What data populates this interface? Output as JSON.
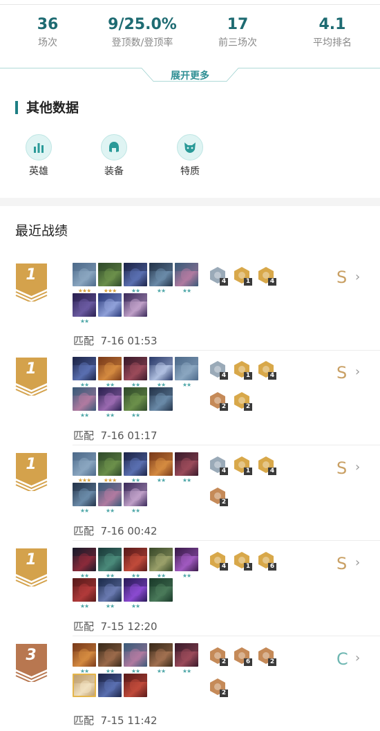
{
  "stats": [
    {
      "value": "36",
      "label": "场次"
    },
    {
      "value": "9/25.0%",
      "label": "登顶数/登顶率"
    },
    {
      "value": "17",
      "label": "前三场次"
    },
    {
      "value": "4.1",
      "label": "平均排名"
    }
  ],
  "expand_label": "展开更多",
  "other_data": {
    "title": "其他数据",
    "items": [
      {
        "label": "英雄",
        "icon": "bar-chart-icon"
      },
      {
        "label": "装备",
        "icon": "helmet-icon"
      },
      {
        "label": "特质",
        "icon": "cat-mask-icon"
      }
    ]
  },
  "recent_title": "最近战绩",
  "colors": {
    "accent": "#1e6b72",
    "gold_badge": "#d4a24c",
    "bronze_badge": "#b87750",
    "grade_s": "#c9a064",
    "grade_c": "#6fb7b2",
    "trait_bronze": "#c58a58",
    "trait_gold": "#d8a84a",
    "trait_silver": "#9aaab8"
  },
  "matches": [
    {
      "rank": "1",
      "badge": "gold",
      "mode": "匹配",
      "time": "7-16 01:53",
      "grade": "S",
      "champions": [
        {
          "colors": [
            "#4d6a8a",
            "#8aa6c0"
          ],
          "stars": 3
        },
        {
          "colors": [
            "#2f4a2a",
            "#6b8f4a"
          ],
          "stars": 3
        },
        {
          "colors": [
            "#1c2448",
            "#5a6fb0"
          ],
          "stars": 2
        },
        {
          "colors": [
            "#24344a",
            "#6a8aa8"
          ],
          "stars": 2
        },
        {
          "colors": [
            "#3a5a78",
            "#b07aa0"
          ],
          "stars": 2
        },
        {
          "colors": [
            "#2a2050",
            "#6a5aa0"
          ],
          "stars": 2
        },
        {
          "colors": [
            "#2a3a7a",
            "#8fa0d8"
          ],
          "stars": 0
        },
        {
          "colors": [
            "#3a2a5a",
            "#c0a0c8"
          ],
          "stars": 0
        }
      ],
      "traits": [
        {
          "tier": "silver",
          "count": "4"
        },
        {
          "tier": "gold",
          "count": "1"
        },
        {
          "tier": "gold",
          "count": "4"
        }
      ]
    },
    {
      "rank": "1",
      "badge": "gold",
      "mode": "匹配",
      "time": "7-16 01:17",
      "grade": "S",
      "champions": [
        {
          "colors": [
            "#1c2448",
            "#5a6fb0"
          ],
          "stars": 2
        },
        {
          "colors": [
            "#7a3a1a",
            "#d48a40"
          ],
          "stars": 2
        },
        {
          "colors": [
            "#3a1a2a",
            "#9a4a5a"
          ],
          "stars": 2
        },
        {
          "colors": [
            "#2a3a6a",
            "#b0c0e0"
          ],
          "stars": 2
        },
        {
          "colors": [
            "#4d6a8a",
            "#8aa6c0"
          ],
          "stars": 2
        },
        {
          "colors": [
            "#3a5a78",
            "#b07aa0"
          ],
          "stars": 2
        },
        {
          "colors": [
            "#2a2050",
            "#9a6ab0"
          ],
          "stars": 2
        },
        {
          "colors": [
            "#2f4a2a",
            "#6b8f4a"
          ],
          "stars": 2
        },
        {
          "colors": [
            "#24344a",
            "#6a8aa8"
          ],
          "stars": 0
        }
      ],
      "traits": [
        {
          "tier": "silver",
          "count": "4"
        },
        {
          "tier": "gold",
          "count": "1"
        },
        {
          "tier": "gold",
          "count": "4"
        },
        {
          "tier": "bronze",
          "count": "2"
        },
        {
          "tier": "gold",
          "count": "2"
        }
      ]
    },
    {
      "rank": "1",
      "badge": "gold",
      "mode": "匹配",
      "time": "7-16 00:42",
      "grade": "S",
      "champions": [
        {
          "colors": [
            "#4d6a8a",
            "#8aa6c0"
          ],
          "stars": 3
        },
        {
          "colors": [
            "#2f4a2a",
            "#6b8f4a"
          ],
          "stars": 3
        },
        {
          "colors": [
            "#1c2448",
            "#5a6fb0"
          ],
          "stars": 2
        },
        {
          "colors": [
            "#7a3a1a",
            "#d48a40"
          ],
          "stars": 2
        },
        {
          "colors": [
            "#3a1a2a",
            "#9a4a5a"
          ],
          "stars": 2
        },
        {
          "colors": [
            "#24344a",
            "#6a8aa8"
          ],
          "stars": 2
        },
        {
          "colors": [
            "#3a5a78",
            "#b07aa0"
          ],
          "stars": 2
        },
        {
          "colors": [
            "#3a2a5a",
            "#c0a0c8"
          ],
          "stars": 2
        }
      ],
      "traits": [
        {
          "tier": "silver",
          "count": "4"
        },
        {
          "tier": "gold",
          "count": "1"
        },
        {
          "tier": "gold",
          "count": "4"
        },
        {
          "tier": "bronze",
          "count": "2"
        }
      ]
    },
    {
      "rank": "1",
      "badge": "gold",
      "mode": "匹配",
      "time": "7-15 12:20",
      "grade": "S",
      "champions": [
        {
          "colors": [
            "#1a1a2a",
            "#8a2a3a"
          ],
          "stars": 2
        },
        {
          "colors": [
            "#1a3a3a",
            "#4a8a7a"
          ],
          "stars": 2
        },
        {
          "colors": [
            "#5a1a1a",
            "#c04a3a"
          ],
          "stars": 2
        },
        {
          "colors": [
            "#3a4a2a",
            "#9aa06a"
          ],
          "stars": 2
        },
        {
          "colors": [
            "#3a1a4a",
            "#a05ac0"
          ],
          "stars": 2
        },
        {
          "colors": [
            "#5a1a1a",
            "#b03a3a"
          ],
          "stars": 2
        },
        {
          "colors": [
            "#1a2a4a",
            "#6a7ab0"
          ],
          "stars": 2
        },
        {
          "colors": [
            "#2a1a5a",
            "#8a4ad0"
          ],
          "stars": 2
        },
        {
          "colors": [
            "#1a3a2a",
            "#4a7a5a"
          ],
          "stars": 0
        }
      ],
      "traits": [
        {
          "tier": "gold",
          "count": "4"
        },
        {
          "tier": "gold",
          "count": "1"
        },
        {
          "tier": "gold",
          "count": "6"
        }
      ]
    },
    {
      "rank": "3",
      "badge": "bronze",
      "mode": "匹配",
      "time": "7-15 11:42",
      "grade": "C",
      "champions": [
        {
          "colors": [
            "#7a3a1a",
            "#d48a40"
          ],
          "stars": 2
        },
        {
          "colors": [
            "#3a2a1a",
            "#9a6a4a"
          ],
          "stars": 2
        },
        {
          "colors": [
            "#3a5a78",
            "#b07aa0"
          ],
          "stars": 2
        },
        {
          "colors": [
            "#3a2a1a",
            "#a07050"
          ],
          "stars": 2
        },
        {
          "colors": [
            "#3a1a2a",
            "#9a4a5a"
          ],
          "stars": 2
        },
        {
          "colors": [
            "#c0a070",
            "#f0e0c0"
          ],
          "stars": 0,
          "gold": true
        },
        {
          "colors": [
            "#1c2448",
            "#5a6fb0"
          ],
          "stars": 0
        },
        {
          "colors": [
            "#5a1a1a",
            "#c04a3a"
          ],
          "stars": 0
        }
      ],
      "traits": [
        {
          "tier": "bronze",
          "count": "2"
        },
        {
          "tier": "bronze",
          "count": "6"
        },
        {
          "tier": "bronze",
          "count": "2"
        },
        {
          "tier": "bronze",
          "count": "2"
        }
      ]
    }
  ]
}
